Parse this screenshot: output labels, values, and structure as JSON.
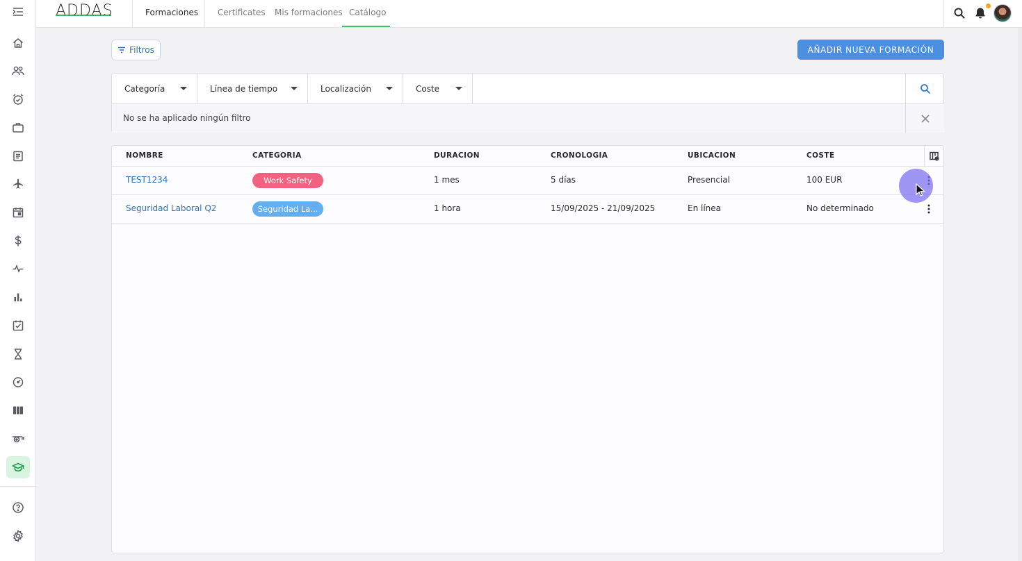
{
  "app": {
    "logo": "ADDAS",
    "section_title": "Formaciones",
    "nav_tabs": [
      {
        "label": "Certificates",
        "active": false
      },
      {
        "label": "Mis formaciones",
        "active": false
      },
      {
        "label": "Catálogo",
        "active": true
      }
    ]
  },
  "sidebar": {
    "items": [
      "menu-collapse",
      "home",
      "people",
      "alarm-check",
      "briefcase",
      "document",
      "airplane",
      "calendar",
      "dollar",
      "activity",
      "bar-chart",
      "checkbox",
      "hourglass",
      "gauge",
      "columns",
      "whistle",
      "graduation-cap",
      "help",
      "settings"
    ],
    "active": "graduation-cap"
  },
  "toolbar": {
    "filter_label": "Filtros",
    "add_label": "AÑADIR NUEVA FORMACIÓN"
  },
  "filters": {
    "dropdowns": [
      "Categoría",
      "Línea de tiempo",
      "Localización",
      "Coste"
    ],
    "search_value": "",
    "status": "No se ha aplicado ningún filtro"
  },
  "table": {
    "headers": [
      "NOMBRE",
      "CATEGORIA",
      "DURACION",
      "CRONOLOGIA",
      "UBICACION",
      "COSTE"
    ],
    "rows": [
      {
        "name": "TEST1234",
        "category": "Work Safety",
        "category_color": "#f0627f",
        "duration": "1 mes",
        "timeline": "5 días",
        "location": "Presencial",
        "cost": "100 EUR"
      },
      {
        "name": "Seguridad Laboral Q2",
        "category": "Seguridad La...",
        "category_color": "#62aef0",
        "duration": "1 hora",
        "timeline": "15/09/2025 - 21/09/2025",
        "location": "En línea",
        "cost": "No determinado"
      }
    ]
  },
  "colors": {
    "accent": "#4c8ee0",
    "link": "#2f6fc2",
    "active_green": "#1f9b4a",
    "notification": "#f5a524"
  }
}
